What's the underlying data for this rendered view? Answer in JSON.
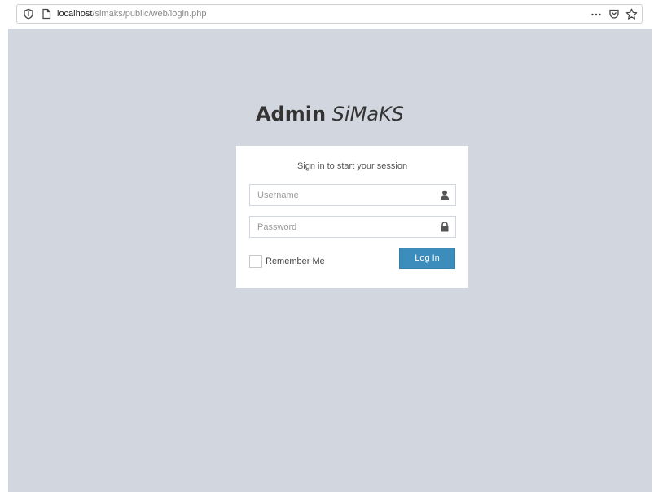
{
  "browser": {
    "url_host": "localhost",
    "url_path": "/simaks/public/web/login.php",
    "icons": {
      "site_info": "shield-icon",
      "page": "page-icon",
      "more": "more-icon",
      "pocket": "pocket-icon",
      "bookmark": "star-icon"
    }
  },
  "page": {
    "title_bold": "Admin",
    "title_italic": "SiMaKS",
    "background": "#d2d6de"
  },
  "login": {
    "message": "Sign in to start your session",
    "username_placeholder": "Username",
    "password_placeholder": "Password",
    "remember_label": "Remember Me",
    "remember_checked": false,
    "button_label": "Log In",
    "button_color": "#3c8dbc"
  }
}
